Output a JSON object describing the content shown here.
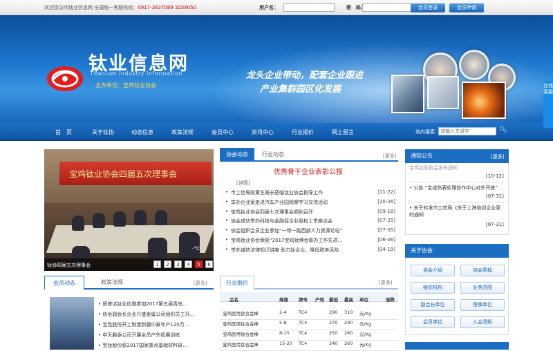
{
  "topbar": {
    "welcome": "欢迎您访问钛业信息网 全国统一客服热线：",
    "hotline": "0917-3637089 3258050",
    "username_label": "用户名：",
    "password_label": "密　码：",
    "login_button": "会员登录",
    "register_button": "会员申请"
  },
  "banner": {
    "site_name": "钛业信息网",
    "site_name_en": "Titanium Industry Information",
    "organizer": "主办单位：宝鸡钛业协会",
    "slogan_line1": "龙头企业带动，配套企业跟进",
    "slogan_line2": "产业集群园区化发展"
  },
  "nav": {
    "items": [
      "首　页",
      "关于钛协",
      "动态信息",
      "政策法规",
      "会员中心",
      "资讯中心",
      "行业报价",
      "网上留言"
    ],
    "search_label": "站内搜索：",
    "search_placeholder": "请输入关键字"
  },
  "side_tab": "在线客服",
  "slideshow": {
    "banner_text": "宝鸡钛业协会四届五次理事会",
    "caption": "钛协四届五次理事会",
    "pages": [
      "1",
      "2",
      "3",
      "4",
      "5",
      "6"
    ],
    "active_page": 5,
    "weather": "-°C"
  },
  "news": {
    "tabs": [
      "协会动态",
      "行业动态"
    ],
    "more": "[更多]",
    "headline": "优秀骨干企业表彰公报",
    "detail": "[详情]",
    "items": [
      {
        "title": "市工信局段黄生局长莅临钛业协会指导工作",
        "date": "[11-22]"
      },
      {
        "title": "举办企业家走进汽车产业园观摩学习交流活动",
        "date": "[10-26]"
      },
      {
        "title": "宝鸡钛业协会四届七次理事会顺利召开",
        "date": "[09-18]"
      },
      {
        "title": "协会成功举办科技与金融促企业股权上市座谈会",
        "date": "[07-25]"
      },
      {
        "title": "协会组织会员企业参加“一带一路西部人力资源论坛”",
        "date": "[07-05]"
      },
      {
        "title": "宝鸡钛业协会荣获“2017宝鸡钛博会筹办工作先进…",
        "date": "[06-06]"
      },
      {
        "title": "举办诚信法律知识讲座 助力钛企业、降低税务风险",
        "date": "[04-19]"
      }
    ]
  },
  "notice": {
    "title": "通知公告",
    "more": "[更多]",
    "items": [
      {
        "title": "宝鸡钛业协会发布通知",
        "date": "[10-12]"
      },
      {
        "title": "公告 “宝成热表处理协作中心对外开放”",
        "date": "[07-31]"
      },
      {
        "title": "关于转发市工信局《关于上海培训企业家的通知",
        "date": "[07-31]"
      }
    ]
  },
  "about": {
    "title": "关于协会",
    "buttons": [
      "协会介绍",
      "协会章程",
      "组织机构",
      "业务范围",
      "副会长单位",
      "理事单位",
      "会员单位",
      "入会须知"
    ]
  },
  "member_news": {
    "tabs": [
      "会员动态",
      "政策法规"
    ],
    "more": "[更多]",
    "items": [
      "拓普达钛业应邀参加2017第五届青岛…",
      "协会副会长企业兴盛金属公司组织员工开…",
      "宝色股份开工制造新疆中泰年产120万…",
      "中天鹏泰公司开展全员户外拓展训练",
      "宝钛股份获2017国家重点基础材料研…"
    ]
  },
  "price": {
    "tab": "行业报价",
    "more": "[更多]",
    "headers": [
      "品名",
      "规格",
      "牌号",
      "产地",
      "最低",
      "最高",
      "单位",
      "涨跌"
    ],
    "rows": [
      [
        "宝鸡医用钛合金棒",
        "2-4",
        "TC4",
        "",
        "290",
        "310",
        "元/Kg",
        ""
      ],
      [
        "宝鸡医用钛合金棒",
        "5-8",
        "TC4",
        "",
        "270",
        "290",
        "元/Kg",
        ""
      ],
      [
        "宝鸡医用钛合金棒",
        "8-15",
        "TC4",
        "",
        "250",
        "260",
        "元/Kg",
        ""
      ],
      [
        "宝鸡医用钛合金棒",
        "15-20",
        "TC4",
        "",
        "240",
        "260",
        "元/Kg",
        ""
      ]
    ]
  },
  "colors": {
    "brand_blue": "#1b6ec2",
    "headline_red": "#d11a1a",
    "hotline_red": "#d60000"
  }
}
